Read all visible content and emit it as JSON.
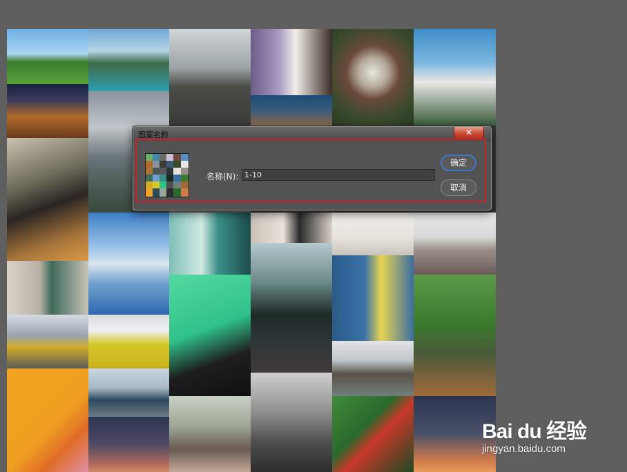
{
  "dialog": {
    "title": "图案名称",
    "close_label": "✕",
    "name_label": "名称(N):",
    "name_value": "1-10",
    "ok_label": "确定",
    "cancel_label": "取消"
  },
  "watermark": {
    "brand": "Bai du 经验",
    "url": "jingyan.baidu.com"
  },
  "colors": {
    "workspace_bg": "#5f5f5f",
    "dialog_bg": "#535353",
    "highlight_red": "#c8252b",
    "ok_focus_blue": "#3f78c8",
    "close_red": "#c94a34"
  }
}
